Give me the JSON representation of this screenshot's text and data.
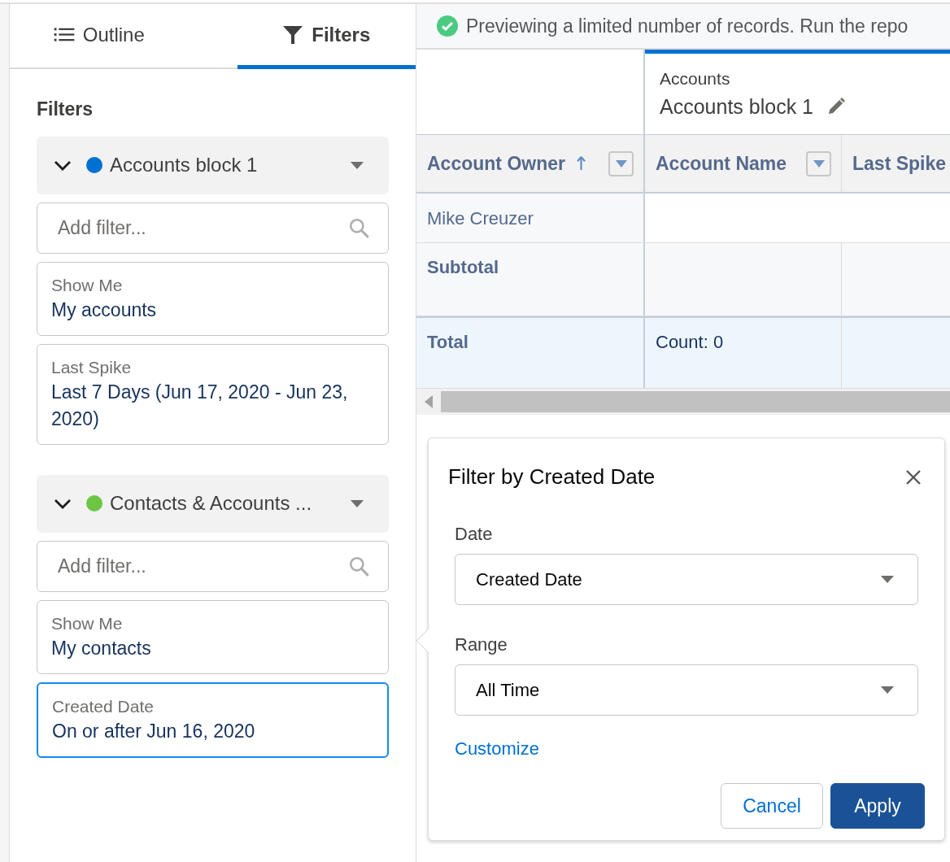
{
  "sidebar": {
    "tabs": [
      {
        "label": "Outline",
        "kind": "list",
        "selected": false
      },
      {
        "label": "Filters",
        "kind": "filter",
        "selected": true
      }
    ],
    "heading": "Filters",
    "blocks": [
      {
        "name": "Accounts block 1",
        "color": "#0070d2",
        "expanded": true,
        "add_filter": {
          "placeholder": "Add filter..."
        },
        "filters": [
          {
            "label": "Show Me",
            "value": "My accounts",
            "selected": false
          },
          {
            "label": "Last Spike",
            "value": "Last 7 Days (Jun 17, 2020 - Jun 23, 2020)",
            "selected": false
          }
        ]
      },
      {
        "name": "Contacts & Accounts ...",
        "color": "#6cc644",
        "expanded": true,
        "add_filter": {
          "placeholder": "Add filter..."
        },
        "filters": [
          {
            "label": "Show Me",
            "value": "My contacts",
            "selected": false
          },
          {
            "label": "Created Date",
            "value": "On or after Jun 16, 2020",
            "selected": true
          }
        ]
      }
    ]
  },
  "banner": {
    "text": "Previewing a limited number of records. Run the repo"
  },
  "table": {
    "block_type": "Accounts",
    "block_name": "Accounts block 1",
    "columns": [
      {
        "label": "Account Owner",
        "sorted": true
      },
      {
        "label": "Account Name",
        "sorted": false
      },
      {
        "label": "Last Spike",
        "sorted": false
      }
    ],
    "rows": [
      {
        "kind": "record",
        "cells": [
          "Mike Creuzer"
        ]
      },
      {
        "kind": "subtotal",
        "cells": [
          "Subtotal"
        ]
      },
      {
        "kind": "total",
        "cells": [
          "Total",
          "Count: 0"
        ]
      }
    ]
  },
  "popover": {
    "title": "Filter by Created Date",
    "fields": [
      {
        "label": "Date",
        "value": "Created Date"
      },
      {
        "label": "Range",
        "value": "All Time"
      }
    ],
    "link": "Customize",
    "buttons": [
      {
        "label": "Cancel",
        "kind": "neutral"
      },
      {
        "label": "Apply",
        "kind": "brand"
      }
    ]
  }
}
